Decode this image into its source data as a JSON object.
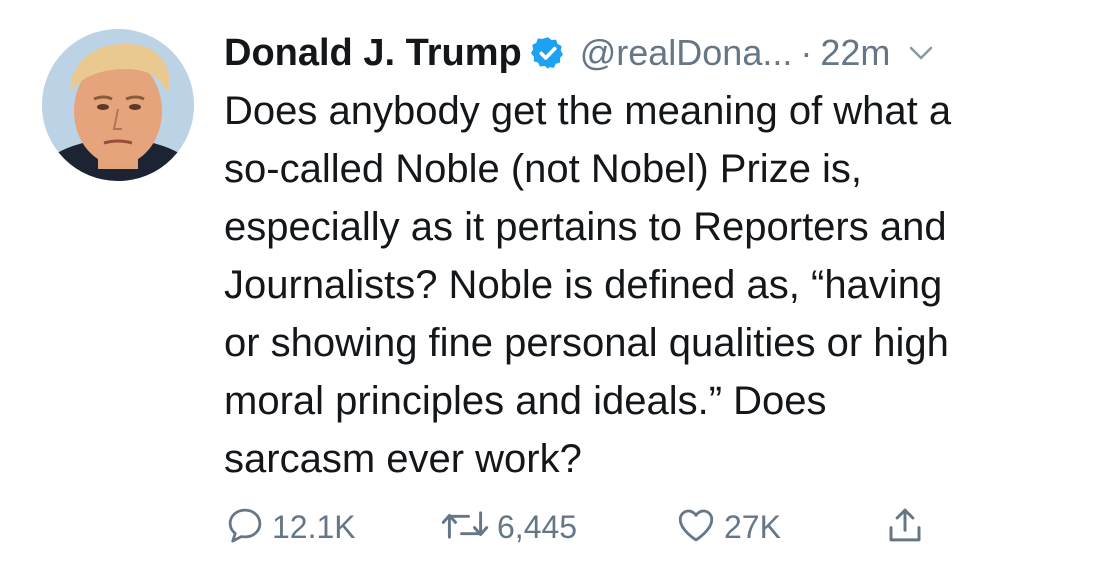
{
  "tweet": {
    "author": {
      "name": "Donald J. Trump",
      "handle": "@realDona...",
      "verified": true
    },
    "separator": "·",
    "time": "22m",
    "text": "Does anybody get the meaning of what a\nso-called Noble (not Nobel) Prize is,\nespecially as it pertains to Reporters and\nJournalists? Noble is defined as, “having\nor showing fine personal qualities or high\nmoral principles and ideals.” Does\nsarcasm ever work?",
    "actions": {
      "replies": "12.1K",
      "retweets": "6,445",
      "likes": "27K"
    },
    "icons": {
      "reply": "reply-icon",
      "retweet": "retweet-icon",
      "like": "heart-icon",
      "share": "share-icon",
      "verified": "verified-badge-icon",
      "menu": "chevron-down-icon"
    },
    "colors": {
      "text": "#14171a",
      "secondary": "#657786",
      "verified": "#1da1f2",
      "background": "#ffffff"
    }
  }
}
